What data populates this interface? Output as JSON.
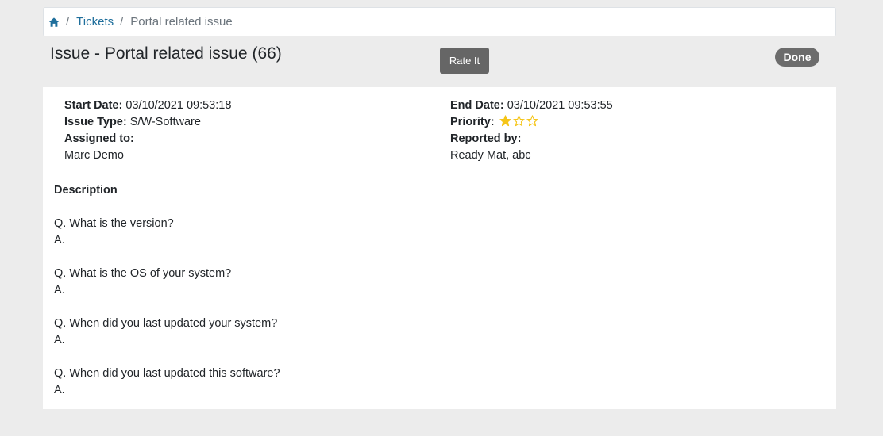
{
  "breadcrumb": {
    "home_icon": "home-icon",
    "separator": "/",
    "tickets": "Tickets",
    "current": "Portal related issue"
  },
  "header": {
    "title": "Issue - Portal related issue (66)",
    "rate_button": "Rate It",
    "status": "Done"
  },
  "details": {
    "start_date_label": "Start Date:",
    "start_date": "03/10/2021 09:53:18",
    "issue_type_label": "Issue Type:",
    "issue_type": "S/W-Software",
    "assigned_label": "Assigned to:",
    "assigned_to": "Marc Demo",
    "end_date_label": "End Date:",
    "end_date": "03/10/2021 09:53:55",
    "priority_label": "Priority:",
    "priority_stars": 1,
    "priority_max": 3,
    "reported_label": "Reported by:",
    "reported_by": "Ready Mat, abc"
  },
  "description": {
    "heading": "Description",
    "items": [
      {
        "q": "Q. What is the version?",
        "a": "A."
      },
      {
        "q": "Q. What is the OS of your system?",
        "a": "A."
      },
      {
        "q": "Q. When did you last updated your system?",
        "a": "A."
      },
      {
        "q": "Q. When did you last updated this software?",
        "a": "A."
      }
    ]
  },
  "colors": {
    "link": "#1f6f9c",
    "star": "#f5c518",
    "button": "#666666",
    "badge": "#6c6c6c"
  }
}
